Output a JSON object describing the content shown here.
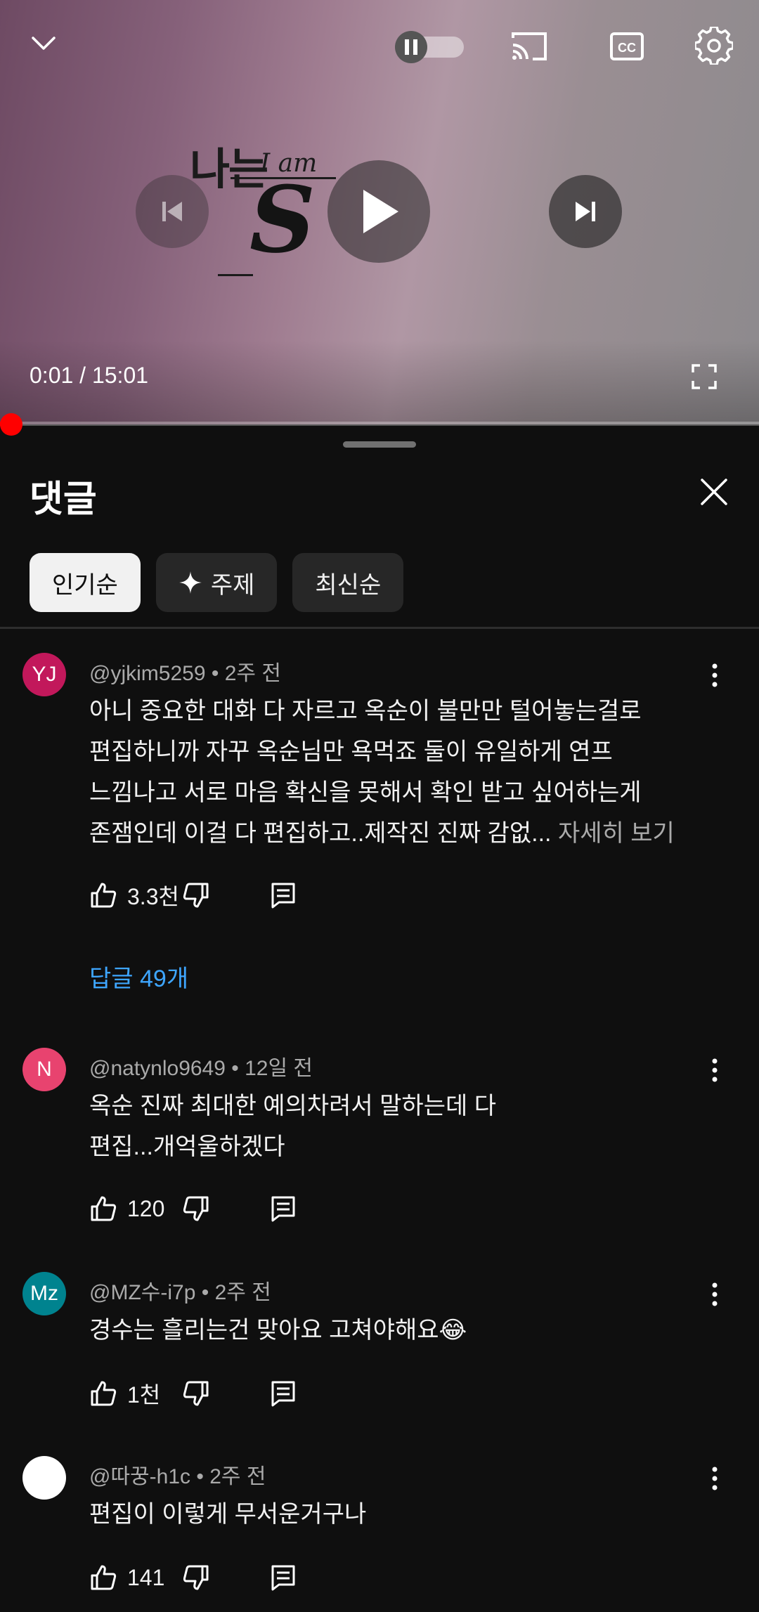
{
  "player": {
    "title_art_ko": "나는",
    "title_art_en": "I am",
    "title_art_s": "S",
    "time_display": "0:01 / 15:01",
    "progress_fraction": 0.001,
    "accent_color": "#ff0000"
  },
  "comments_panel": {
    "title": "댓글",
    "chips": [
      {
        "label": "인기순",
        "active": true
      },
      {
        "label": "주제",
        "icon": "sparkle-icon",
        "active": false
      },
      {
        "label": "최신순",
        "active": false
      }
    ],
    "comments": [
      {
        "avatar_text": "YJ",
        "avatar_color": "#c2185b",
        "handle": "@yjkim5259",
        "time": "2주 전",
        "lines": [
          "아니 중요한 대화 다 자르고 옥순이 불만만 털어놓는걸로",
          "편집하니까 자꾸 옥순님만 욕먹죠 둘이 유일하게 연프",
          "느낌나고 서로 마음 확신을 못해서 확인 받고 싶어하는게",
          "존잼인데 이걸 다 편집하고..제작진 진짜 감없..."
        ],
        "more": "자세히 보기",
        "likes": "3.3천",
        "replies": "답글 49개"
      },
      {
        "avatar_text": "N",
        "avatar_color": "#e8436f",
        "handle": "@natynlo9649",
        "time": "12일 전",
        "lines": [
          "옥순 진짜 최대한 예의차려서 말하는데 다",
          "편집...개억울하겠다"
        ],
        "likes": "120"
      },
      {
        "avatar_text": "Mz",
        "avatar_color": "#00838f",
        "handle": "@MZ수-i7p",
        "time": "2주 전",
        "lines": [
          "경수는 흘리는건 맞아요 고쳐야해요😂"
        ],
        "likes": "1천"
      },
      {
        "avatar_text": "",
        "avatar_color": "#ffffff",
        "handle": "@따꿍-h1c",
        "time": "2주 전",
        "lines": [
          "편집이 이렇게 무서운거구나"
        ],
        "likes": "141"
      }
    ]
  }
}
